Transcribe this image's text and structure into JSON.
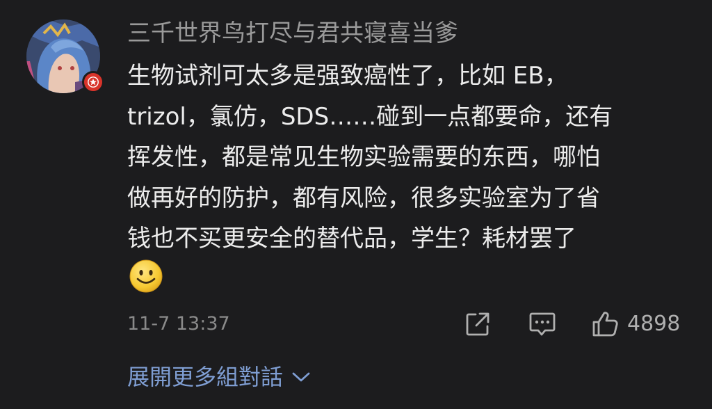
{
  "comment": {
    "username": "三千世界鸟打尽与君共寝喜当爹",
    "body_lines": [
      "生物试剂可太多是强致癌性了，比如 EB，",
      "trizol，氯仿，SDS……碰到一点都要命，还有",
      "挥发性，都是常见生物实验需要的东西，哪怕",
      "做再好的防护，都有风险，很多实验室为了省",
      "钱也不买更安全的替代品，学生？耗材罢了"
    ],
    "emoji": "smiling-face",
    "timestamp": "11-7 13:37",
    "like_count": "4898",
    "expand_label": "展開更多組對話"
  },
  "colors": {
    "background": "#1c1c1e",
    "text": "#ececec",
    "muted": "#9a9a9a",
    "link": "#7f9ed3",
    "badge": "#d8342b"
  },
  "icons": {
    "share": "share-icon",
    "reply": "comment-icon",
    "like": "thumbs-up-icon",
    "expand": "chevron-down-icon",
    "badge": "star-badge-icon"
  }
}
